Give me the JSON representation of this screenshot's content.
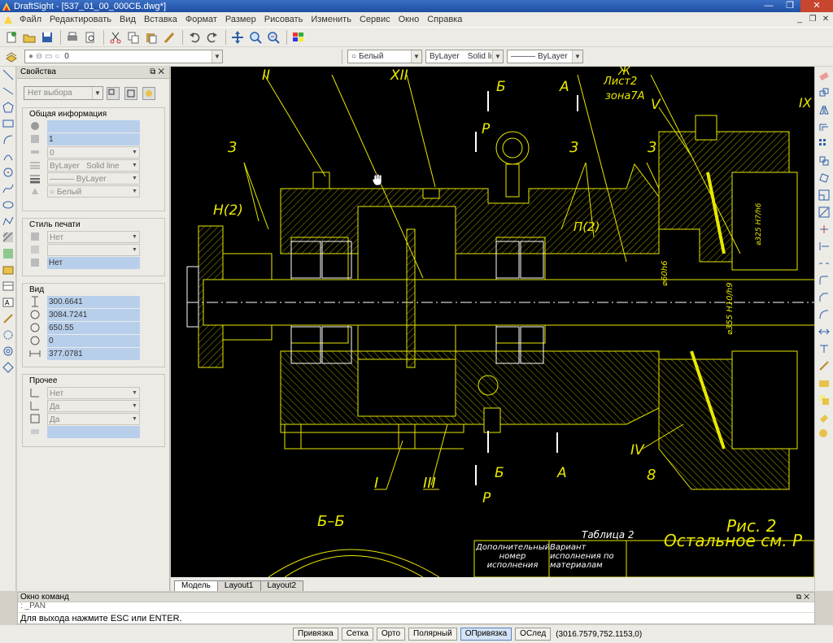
{
  "window": {
    "title": "DraftSight - [537_01_00_000СБ.dwg*]"
  },
  "menu": [
    "Файл",
    "Редактировать",
    "Вид",
    "Вставка",
    "Формат",
    "Размер",
    "Рисовать",
    "Изменить",
    "Сервис",
    "Окно",
    "Справка"
  ],
  "layer_bar": {
    "layer_value": "0",
    "color_value": "Белый",
    "linetype_value": "ByLayer",
    "linetype_style": "Solid line",
    "lineweight_value": "ByLayer"
  },
  "properties": {
    "title": "Свойства",
    "selection": "Нет выбора",
    "general": {
      "title": "Общая информация",
      "rows": [
        "",
        "1",
        "0",
        "ByLayer",
        "ByLayer",
        "Белый"
      ],
      "linetype_style": "Solid line",
      "lineweight_prefix": "———"
    },
    "print_style": {
      "title": "Стиль печати",
      "rows": [
        "Нет",
        "",
        "Нет"
      ]
    },
    "view": {
      "title": "Вид",
      "rows": [
        "300.6641",
        "3084.7241",
        "650.55",
        "0",
        "377.0781"
      ]
    },
    "misc": {
      "title": "Прочее",
      "rows": [
        "Нет",
        "Да",
        "Да",
        ""
      ]
    }
  },
  "drawing": {
    "labels": {
      "ii": "II",
      "xii": "XII",
      "b_top": "Б",
      "a_top": "А",
      "zh": "Ж",
      "sheet2": "Лист2",
      "zone7a": "зона7А",
      "v": "V",
      "ix": "IX",
      "p_top": "Р",
      "three1": "3",
      "three2": "3",
      "three3": "3",
      "n2": "Н(2)",
      "p2": "П(2)",
      "d60": "⌀60h6",
      "d325": "⌀325 H7/h6",
      "d355": "⌀355 H10/h9",
      "i": "I",
      "iii": "III",
      "iv": "IV",
      "eight": "8",
      "b_bot": "Б",
      "a_bot": "А",
      "p_bot": "Р",
      "section": "Б–Б",
      "table2": "Таблица 2",
      "fig2": "Рис. 2",
      "rest": "Остальное см. Р",
      "col1": "Дополнительный номер исполнения",
      "col2": "Вариант исполнения по материалам"
    }
  },
  "tabs": [
    "Модель",
    "Layout1",
    "Layout2"
  ],
  "command": {
    "title": "Окно команд",
    "line1": ": _PAN",
    "line2": "Для выхода нажмите ESC или ENTER."
  },
  "status": {
    "buttons": [
      "Привязка",
      "Сетка",
      "Орто",
      "Полярный",
      "ОПривязка",
      "ОСлед"
    ],
    "coords": "(3016.7579,752.1153,0)"
  },
  "colors": {
    "drawing_line": "#e8e800",
    "canvas": "#000000",
    "text_white": "#ffffff",
    "accent_blue": "#b8cfeb"
  }
}
